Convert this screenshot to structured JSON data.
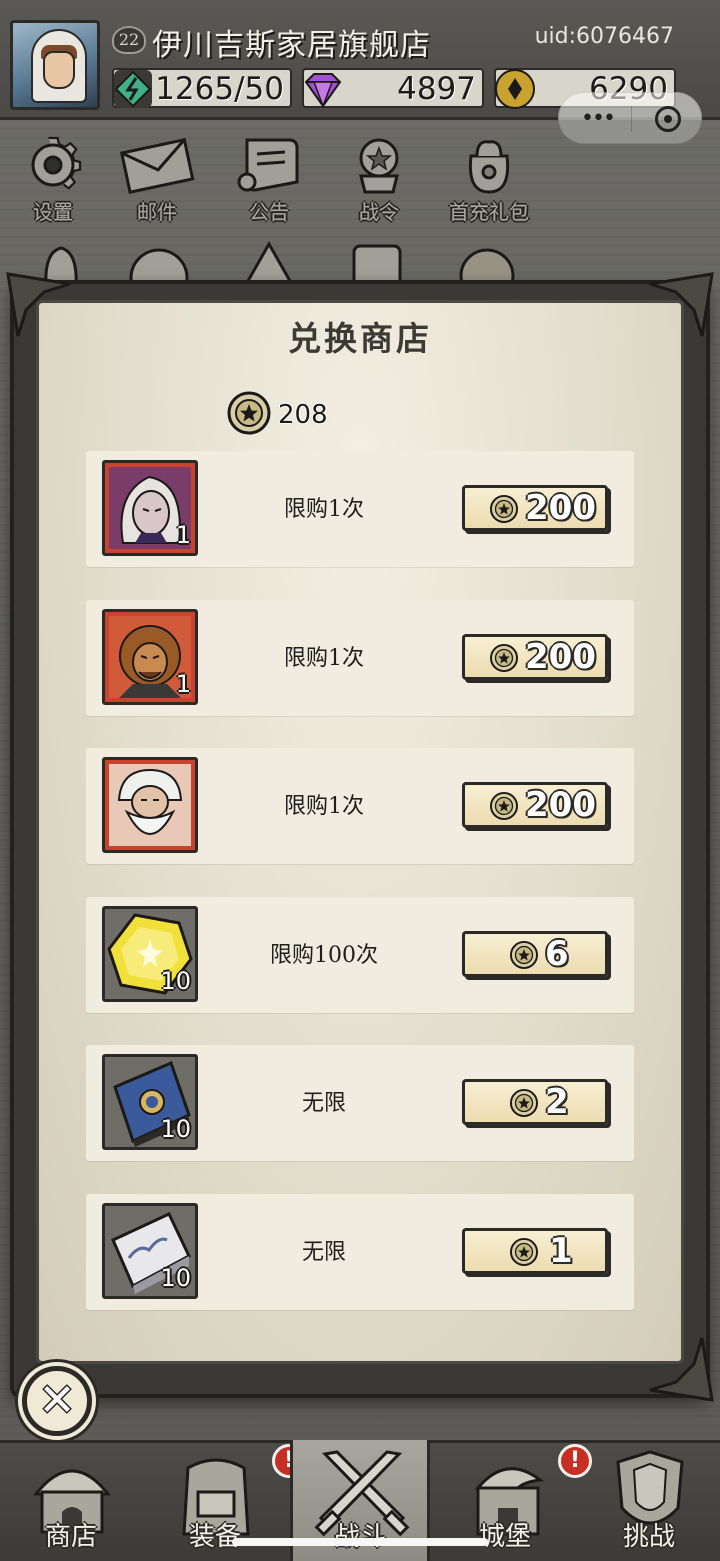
{
  "header": {
    "level": "22",
    "player_name": "伊川吉斯家居旗舰店",
    "uid": "uid:6076467",
    "resources": {
      "energy": "1265/50",
      "gems": "4897",
      "gold": "6290"
    }
  },
  "quick_menu": [
    {
      "label": "设置",
      "icon": "gear-icon"
    },
    {
      "label": "邮件",
      "icon": "mail-icon"
    },
    {
      "label": "公告",
      "icon": "scroll-icon"
    },
    {
      "label": "战令",
      "icon": "battle-pass-icon"
    },
    {
      "label": "首充礼包",
      "icon": "gift-bag-icon"
    }
  ],
  "shop": {
    "title": "兑换商店",
    "currency_balance": "208",
    "items": [
      {
        "icon": "hero-white-hair-portrait",
        "quantity": "1",
        "limit": "限购1次",
        "price": "200"
      },
      {
        "icon": "hero-lion-warrior-portrait",
        "quantity": "1",
        "limit": "限购1次",
        "price": "200"
      },
      {
        "icon": "hero-old-sage-portrait",
        "quantity": "1",
        "limit": "限购1次",
        "price": "200"
      },
      {
        "icon": "yellow-crystal-icon",
        "quantity": "10",
        "limit": "限购100次",
        "price": "6"
      },
      {
        "icon": "blue-tome-icon",
        "quantity": "10",
        "limit": "无限",
        "price": "2"
      },
      {
        "icon": "silver-ingot-icon",
        "quantity": "10",
        "limit": "无限",
        "price": "1"
      }
    ]
  },
  "bottom_nav": [
    {
      "label": "商店",
      "icon": "shop-hut-icon",
      "alert": ""
    },
    {
      "label": "装备",
      "icon": "backpack-icon",
      "alert": "!"
    },
    {
      "label": "战斗",
      "icon": "crossed-swords-icon",
      "alert": ""
    },
    {
      "label": "城堡",
      "icon": "castle-icon",
      "alert": "!"
    },
    {
      "label": "挑战",
      "icon": "shield-crest-icon",
      "alert": ""
    }
  ],
  "colors": {
    "panel": "#e6e1d0",
    "frame": "#3a3935",
    "price_button": "#f3e8c6",
    "alert": "#c62f24",
    "hero_card_bg": "#c9432f"
  }
}
